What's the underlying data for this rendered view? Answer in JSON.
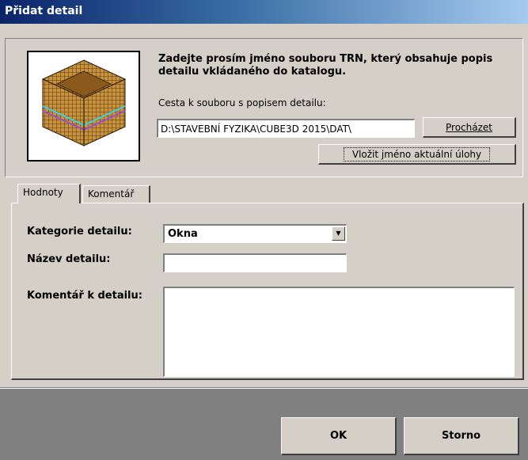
{
  "window": {
    "title": "Přidat detail"
  },
  "intro": {
    "heading": "Zadejte prosím jméno souboru TRN, který obsahuje popis detailu vkládaného do katalogu.",
    "path_label": "Cesta k souboru s popisem detailu:",
    "path_value": "D:\\STAVEBNÍ FYZIKA\\CUBE3D 2015\\DAT\\",
    "browse_label": "Procházet",
    "insert_label": "Vložit jméno aktuální úlohy"
  },
  "tabs": [
    {
      "label": "Hodnoty"
    },
    {
      "label": "Komentář"
    }
  ],
  "form": {
    "category_label": "Kategorie detailu:",
    "category_value": "Okna",
    "name_label": "Název detailu:",
    "name_value": "",
    "comment_label": "Komentář k detailu:",
    "comment_value": ""
  },
  "footer": {
    "ok_label": "OK",
    "cancel_label": "Storno"
  },
  "colors": {
    "title_gradient_start": "#0a246a",
    "title_gradient_end": "#a6caf0",
    "dialog_face": "#d4d0c8",
    "footer_bg": "#808080"
  },
  "icons": {
    "preview": "3d-cube-detail-preview",
    "dropdown": "dropdown-arrow-icon"
  }
}
